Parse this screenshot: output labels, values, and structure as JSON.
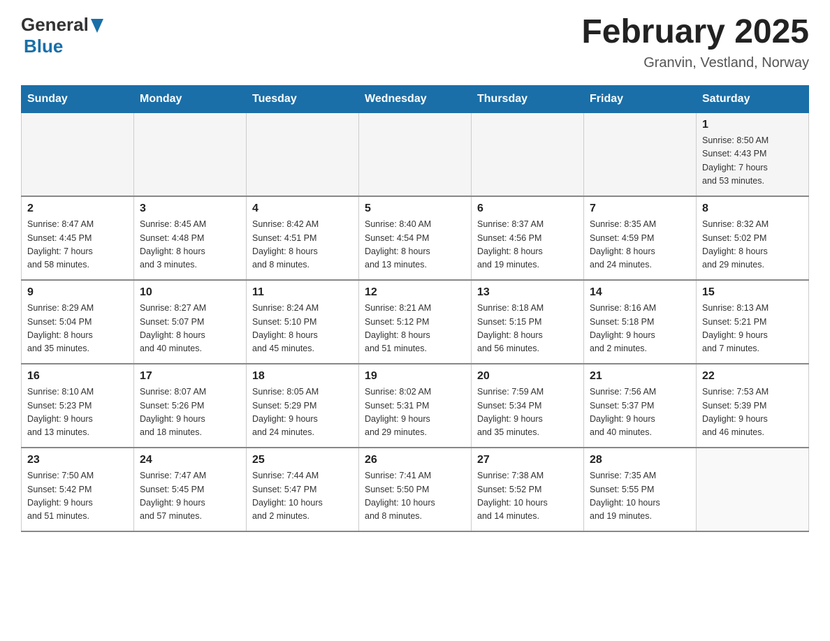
{
  "logo": {
    "text_general": "General",
    "text_blue": "Blue",
    "arrow": "▲"
  },
  "title": "February 2025",
  "subtitle": "Granvin, Vestland, Norway",
  "weekdays": [
    "Sunday",
    "Monday",
    "Tuesday",
    "Wednesday",
    "Thursday",
    "Friday",
    "Saturday"
  ],
  "weeks": [
    [
      {
        "day": "",
        "info": ""
      },
      {
        "day": "",
        "info": ""
      },
      {
        "day": "",
        "info": ""
      },
      {
        "day": "",
        "info": ""
      },
      {
        "day": "",
        "info": ""
      },
      {
        "day": "",
        "info": ""
      },
      {
        "day": "1",
        "info": "Sunrise: 8:50 AM\nSunset: 4:43 PM\nDaylight: 7 hours\nand 53 minutes."
      }
    ],
    [
      {
        "day": "2",
        "info": "Sunrise: 8:47 AM\nSunset: 4:45 PM\nDaylight: 7 hours\nand 58 minutes."
      },
      {
        "day": "3",
        "info": "Sunrise: 8:45 AM\nSunset: 4:48 PM\nDaylight: 8 hours\nand 3 minutes."
      },
      {
        "day": "4",
        "info": "Sunrise: 8:42 AM\nSunset: 4:51 PM\nDaylight: 8 hours\nand 8 minutes."
      },
      {
        "day": "5",
        "info": "Sunrise: 8:40 AM\nSunset: 4:54 PM\nDaylight: 8 hours\nand 13 minutes."
      },
      {
        "day": "6",
        "info": "Sunrise: 8:37 AM\nSunset: 4:56 PM\nDaylight: 8 hours\nand 19 minutes."
      },
      {
        "day": "7",
        "info": "Sunrise: 8:35 AM\nSunset: 4:59 PM\nDaylight: 8 hours\nand 24 minutes."
      },
      {
        "day": "8",
        "info": "Sunrise: 8:32 AM\nSunset: 5:02 PM\nDaylight: 8 hours\nand 29 minutes."
      }
    ],
    [
      {
        "day": "9",
        "info": "Sunrise: 8:29 AM\nSunset: 5:04 PM\nDaylight: 8 hours\nand 35 minutes."
      },
      {
        "day": "10",
        "info": "Sunrise: 8:27 AM\nSunset: 5:07 PM\nDaylight: 8 hours\nand 40 minutes."
      },
      {
        "day": "11",
        "info": "Sunrise: 8:24 AM\nSunset: 5:10 PM\nDaylight: 8 hours\nand 45 minutes."
      },
      {
        "day": "12",
        "info": "Sunrise: 8:21 AM\nSunset: 5:12 PM\nDaylight: 8 hours\nand 51 minutes."
      },
      {
        "day": "13",
        "info": "Sunrise: 8:18 AM\nSunset: 5:15 PM\nDaylight: 8 hours\nand 56 minutes."
      },
      {
        "day": "14",
        "info": "Sunrise: 8:16 AM\nSunset: 5:18 PM\nDaylight: 9 hours\nand 2 minutes."
      },
      {
        "day": "15",
        "info": "Sunrise: 8:13 AM\nSunset: 5:21 PM\nDaylight: 9 hours\nand 7 minutes."
      }
    ],
    [
      {
        "day": "16",
        "info": "Sunrise: 8:10 AM\nSunset: 5:23 PM\nDaylight: 9 hours\nand 13 minutes."
      },
      {
        "day": "17",
        "info": "Sunrise: 8:07 AM\nSunset: 5:26 PM\nDaylight: 9 hours\nand 18 minutes."
      },
      {
        "day": "18",
        "info": "Sunrise: 8:05 AM\nSunset: 5:29 PM\nDaylight: 9 hours\nand 24 minutes."
      },
      {
        "day": "19",
        "info": "Sunrise: 8:02 AM\nSunset: 5:31 PM\nDaylight: 9 hours\nand 29 minutes."
      },
      {
        "day": "20",
        "info": "Sunrise: 7:59 AM\nSunset: 5:34 PM\nDaylight: 9 hours\nand 35 minutes."
      },
      {
        "day": "21",
        "info": "Sunrise: 7:56 AM\nSunset: 5:37 PM\nDaylight: 9 hours\nand 40 minutes."
      },
      {
        "day": "22",
        "info": "Sunrise: 7:53 AM\nSunset: 5:39 PM\nDaylight: 9 hours\nand 46 minutes."
      }
    ],
    [
      {
        "day": "23",
        "info": "Sunrise: 7:50 AM\nSunset: 5:42 PM\nDaylight: 9 hours\nand 51 minutes."
      },
      {
        "day": "24",
        "info": "Sunrise: 7:47 AM\nSunset: 5:45 PM\nDaylight: 9 hours\nand 57 minutes."
      },
      {
        "day": "25",
        "info": "Sunrise: 7:44 AM\nSunset: 5:47 PM\nDaylight: 10 hours\nand 2 minutes."
      },
      {
        "day": "26",
        "info": "Sunrise: 7:41 AM\nSunset: 5:50 PM\nDaylight: 10 hours\nand 8 minutes."
      },
      {
        "day": "27",
        "info": "Sunrise: 7:38 AM\nSunset: 5:52 PM\nDaylight: 10 hours\nand 14 minutes."
      },
      {
        "day": "28",
        "info": "Sunrise: 7:35 AM\nSunset: 5:55 PM\nDaylight: 10 hours\nand 19 minutes."
      },
      {
        "day": "",
        "info": ""
      }
    ]
  ]
}
